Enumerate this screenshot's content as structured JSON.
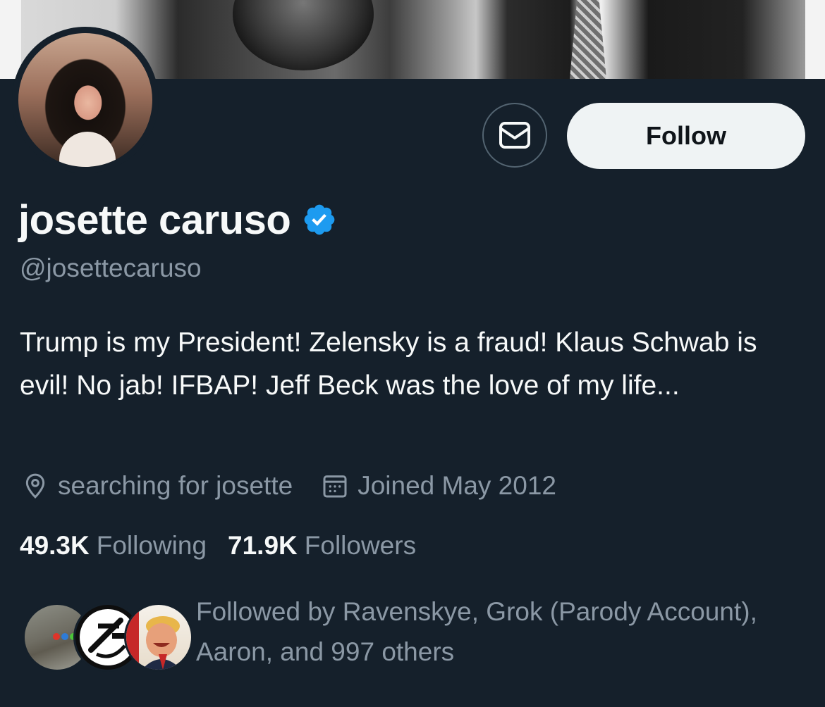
{
  "profile": {
    "display_name": "josette caruso",
    "verified": true,
    "handle": "@josettecaruso",
    "bio": "Trump is my President! Zelensky is a fraud! Klaus Schwab is evil! No jab! IFBAP! Jeff Beck was the love of my life...",
    "location": "searching for josette",
    "joined": "Joined May 2012"
  },
  "actions": {
    "message_icon": "envelope-icon",
    "follow_label": "Follow"
  },
  "stats": {
    "following_count": "49.3K",
    "following_label": "Following",
    "followers_count": "71.9K",
    "followers_label": "Followers"
  },
  "followed_by": {
    "text": "Followed by Ravenskye, Grok (Parody Account), Aaron, and 997 others"
  },
  "colors": {
    "background": "#15202b",
    "text_primary": "#f7f9f9",
    "text_secondary": "#8b98a5",
    "verified_blue": "#1d9bf0",
    "follow_button_bg": "#eff3f4",
    "border": "#536471"
  },
  "icons": {
    "location": "location-pin-icon",
    "calendar": "calendar-icon",
    "verified": "verified-badge-icon"
  }
}
